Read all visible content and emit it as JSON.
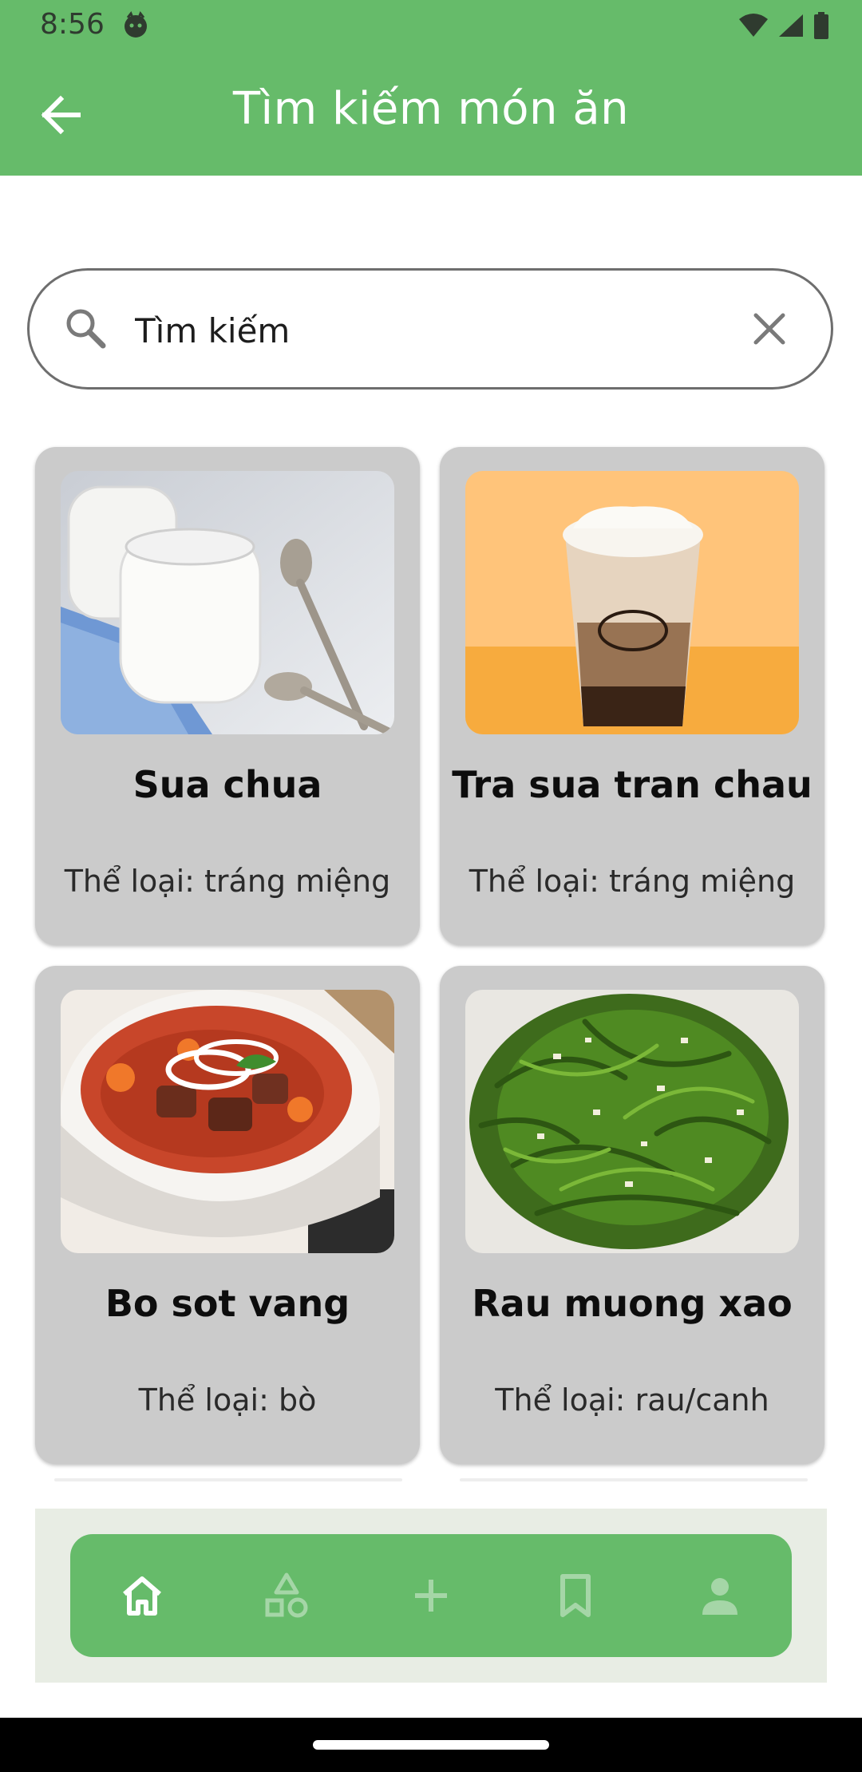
{
  "status_bar": {
    "time": "8:56"
  },
  "app_bar": {
    "title": "Tìm kiếm món ăn"
  },
  "search": {
    "value": "Tìm kiếm",
    "placeholder": "Tìm kiếm"
  },
  "foods": [
    {
      "name": "Sua chua",
      "category": "Thể loại: tráng miệng",
      "image": "yogurt-jars-photo"
    },
    {
      "name": "Tra sua tran chau",
      "category": "Thể loại: tráng miệng",
      "image": "bubble-milk-tea-photo"
    },
    {
      "name": "Bo sot vang",
      "category": "Thể loại: bò",
      "image": "beef-stew-photo"
    },
    {
      "name": "Rau muong xao",
      "category": "Thể loại: rau/canh",
      "image": "stir-fried-morning-glory-photo"
    }
  ],
  "bottom_nav": {
    "items": [
      "home-icon",
      "categories-icon",
      "add-icon",
      "bookmark-icon",
      "profile-icon"
    ],
    "active": "home-icon"
  },
  "colors": {
    "primary": "#66bb6a",
    "card": "#cbcbcb",
    "nav_inactive": "#a5d6a7"
  }
}
